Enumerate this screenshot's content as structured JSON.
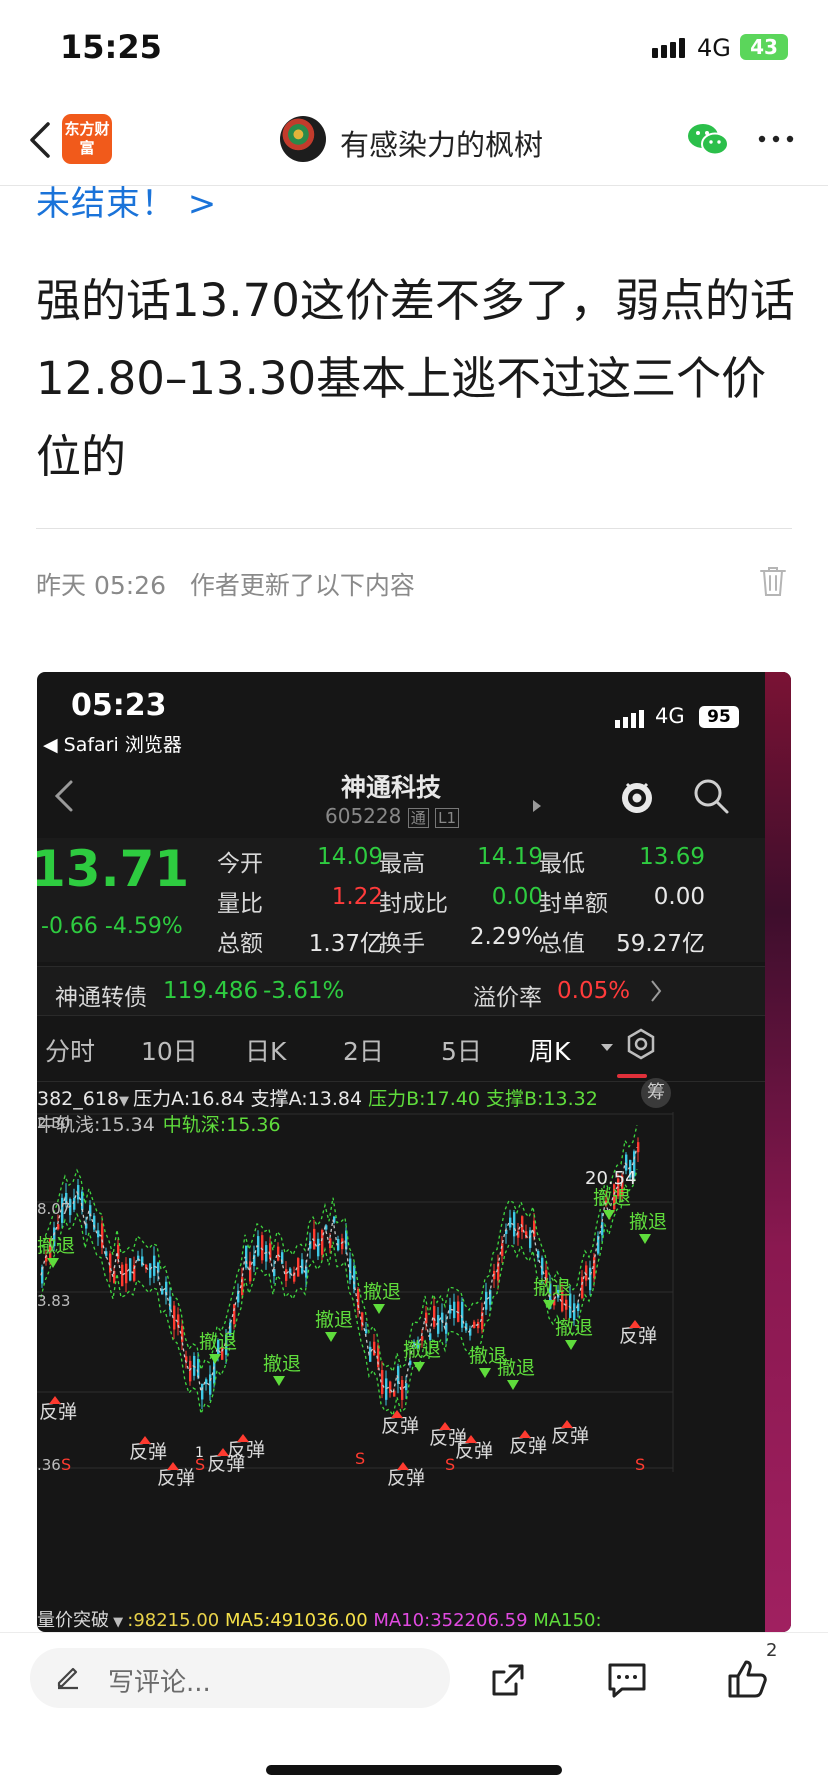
{
  "status_bar": {
    "time": "15:25",
    "network": "4G",
    "battery": "43"
  },
  "nav": {
    "app_logo": "东方财富",
    "author": "有感染力的枫树"
  },
  "article": {
    "link_text": "未结束！ >",
    "body": "强的话13.70这价差不多了，弱点的话12.80–13.30基本上逃不过这三个价位的",
    "update_time": "昨天 05:26",
    "update_note": "作者更新了以下内容"
  },
  "screenshot": {
    "status_time": "05:23",
    "back_app": "◀ Safari 浏览器",
    "network": "4G",
    "battery": "95",
    "stock_name": "神通科技",
    "stock_code": "605228",
    "code_tag1": "通",
    "code_tag2": "L1",
    "price": "13.71",
    "change": "-0.66 -4.59%",
    "quote_fields": [
      {
        "label": "今开",
        "value": "14.09",
        "color": "#2ecc40"
      },
      {
        "label": "最高",
        "value": "14.19",
        "color": "#2ecc40"
      },
      {
        "label": "最低",
        "value": "13.69",
        "color": "#2ecc40"
      },
      {
        "label": "量比",
        "value": "1.22",
        "color": "#ff3b3b"
      },
      {
        "label": "封成比",
        "value": "0.00",
        "color": "#2ecc40"
      },
      {
        "label": "封单额",
        "value": "0.00",
        "color": "#e8e8e8"
      },
      {
        "label": "总额",
        "value": "1.37亿",
        "color": "#e8e8e8"
      },
      {
        "label": "换手",
        "value": "2.29%",
        "color": "#e8e8e8"
      },
      {
        "label": "总值",
        "value": "59.27亿",
        "color": "#e8e8e8"
      }
    ],
    "convertible": {
      "name": "神通转债",
      "price": "119.486",
      "change": "-3.61%",
      "premium_label": "溢价率",
      "premium": "0.05%"
    },
    "tabs": [
      "分时",
      "10日",
      "日K",
      "2日",
      "5日",
      "周K"
    ],
    "indicator_name": "382_618",
    "indicators_row1": [
      {
        "text": "压力A:16.84",
        "color": "#e8e8e8"
      },
      {
        "text": "支撑A:13.84",
        "color": "#e8e8e8"
      },
      {
        "text": "压力B:17.40",
        "color": "#5fdc3c"
      },
      {
        "text": "支撑B:13.32",
        "color": "#5fdc3c"
      }
    ],
    "chip_label": "筹",
    "indicators_row2": [
      {
        "text": "中轨浅:15.34",
        "color": "#bdbdbd"
      },
      {
        "text": "中轨深:15.36",
        "color": "#5fdc3c"
      }
    ],
    "chart_labels": {
      "y1": "2.30",
      "y2": "8.07",
      "y3": "3.83",
      "y4": ".36",
      "max": "20.54",
      "retreat": "撤退",
      "rebound": "反弹",
      "s": "S",
      "one": "1"
    },
    "bottom_indicator": {
      "name": "量价突破",
      "v1": ":98215.00",
      "ma5": "MA5:491036.00",
      "ma10": "MA10:352206.59",
      "ma150": "MA150:"
    }
  },
  "bottom_bar": {
    "comment_placeholder": "写评论...",
    "like_count": "2"
  }
}
